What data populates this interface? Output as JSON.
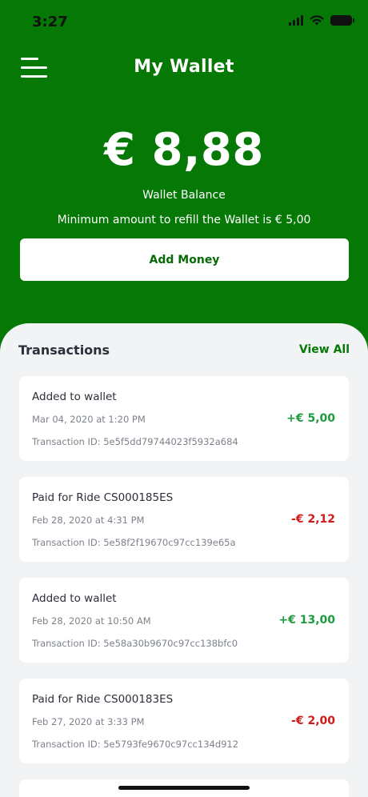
{
  "status_bar": {
    "time": "3:27"
  },
  "header": {
    "title": "My Wallet"
  },
  "wallet": {
    "balance": "€ 8,88",
    "balance_label": "Wallet Balance",
    "refill_note": "Minimum amount to refill the Wallet is € 5,00",
    "add_money_label": "Add Money"
  },
  "transactions": {
    "heading": "Transactions",
    "view_all_label": "View All",
    "items": [
      {
        "title": "Added to wallet",
        "date": "Mar 04, 2020 at 1:20 PM",
        "transaction_id": "Transaction ID: 5e5f5dd79744023f5932a684",
        "amount": "+€ 5,00",
        "type": "credit"
      },
      {
        "title": "Paid for Ride CS000185ES",
        "date": "Feb 28, 2020 at 4:31 PM",
        "transaction_id": "Transaction ID: 5e58f2f19670c97cc139e65a",
        "amount": "-€ 2,12",
        "type": "debit"
      },
      {
        "title": "Added to wallet",
        "date": "Feb 28, 2020 at 10:50 AM",
        "transaction_id": "Transaction ID: 5e58a30b9670c97cc138bfc0",
        "amount": "+€ 13,00",
        "type": "credit"
      },
      {
        "title": "Paid for Ride CS000183ES",
        "date": "Feb 27, 2020 at 3:33 PM",
        "transaction_id": "Transaction ID: 5e5793fe9670c97cc134d912",
        "amount": "-€ 2,00",
        "type": "debit"
      }
    ]
  },
  "colors": {
    "brand_green": "#057805",
    "credit": "#1f9b3f",
    "debit": "#d11a1a",
    "background": "#f2f3f5"
  },
  "icons": [
    "menu-icon",
    "signal-icon",
    "wifi-icon",
    "battery-icon"
  ]
}
